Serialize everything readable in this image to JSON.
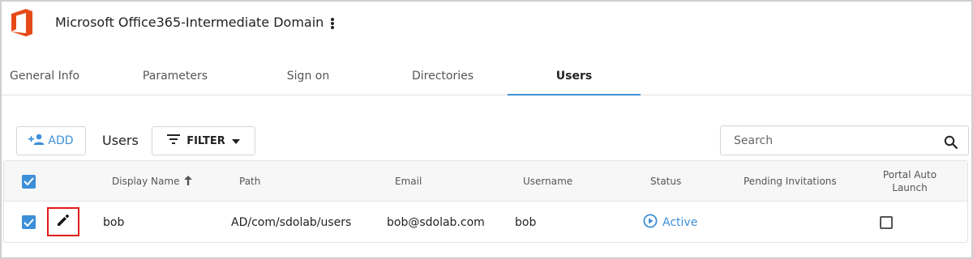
{
  "header": {
    "app_title": "Microsoft Office365-Intermediate Domain",
    "logo_icon": "office-logo-icon",
    "brand_color": "#e64a19"
  },
  "tabs": [
    {
      "label": "General Info",
      "active": false
    },
    {
      "label": "Parameters",
      "active": false
    },
    {
      "label": "Sign on",
      "active": false
    },
    {
      "label": "Directories",
      "active": false
    },
    {
      "label": "Users",
      "active": true
    }
  ],
  "toolbar": {
    "add_label": "ADD",
    "section_label": "Users",
    "filter_label": "FILTER",
    "search_placeholder": "Search"
  },
  "table": {
    "columns": [
      "Display Name",
      "Path",
      "Email",
      "Username",
      "Status",
      "Pending Invitations",
      "Portal Auto Launch"
    ],
    "sort_column": "Display Name",
    "sort_direction": "ascending",
    "header_checkbox_checked": true,
    "rows": [
      {
        "checked": true,
        "display_name": "bob",
        "path": "AD/com/sdolab/users",
        "email": "bob@sdolab.com",
        "username": "bob",
        "status": "Active",
        "pending_invitations": "",
        "portal_auto_launch": false
      }
    ]
  },
  "colors": {
    "accent": "#3d8fd8",
    "highlight_border": "#e01b1b"
  }
}
